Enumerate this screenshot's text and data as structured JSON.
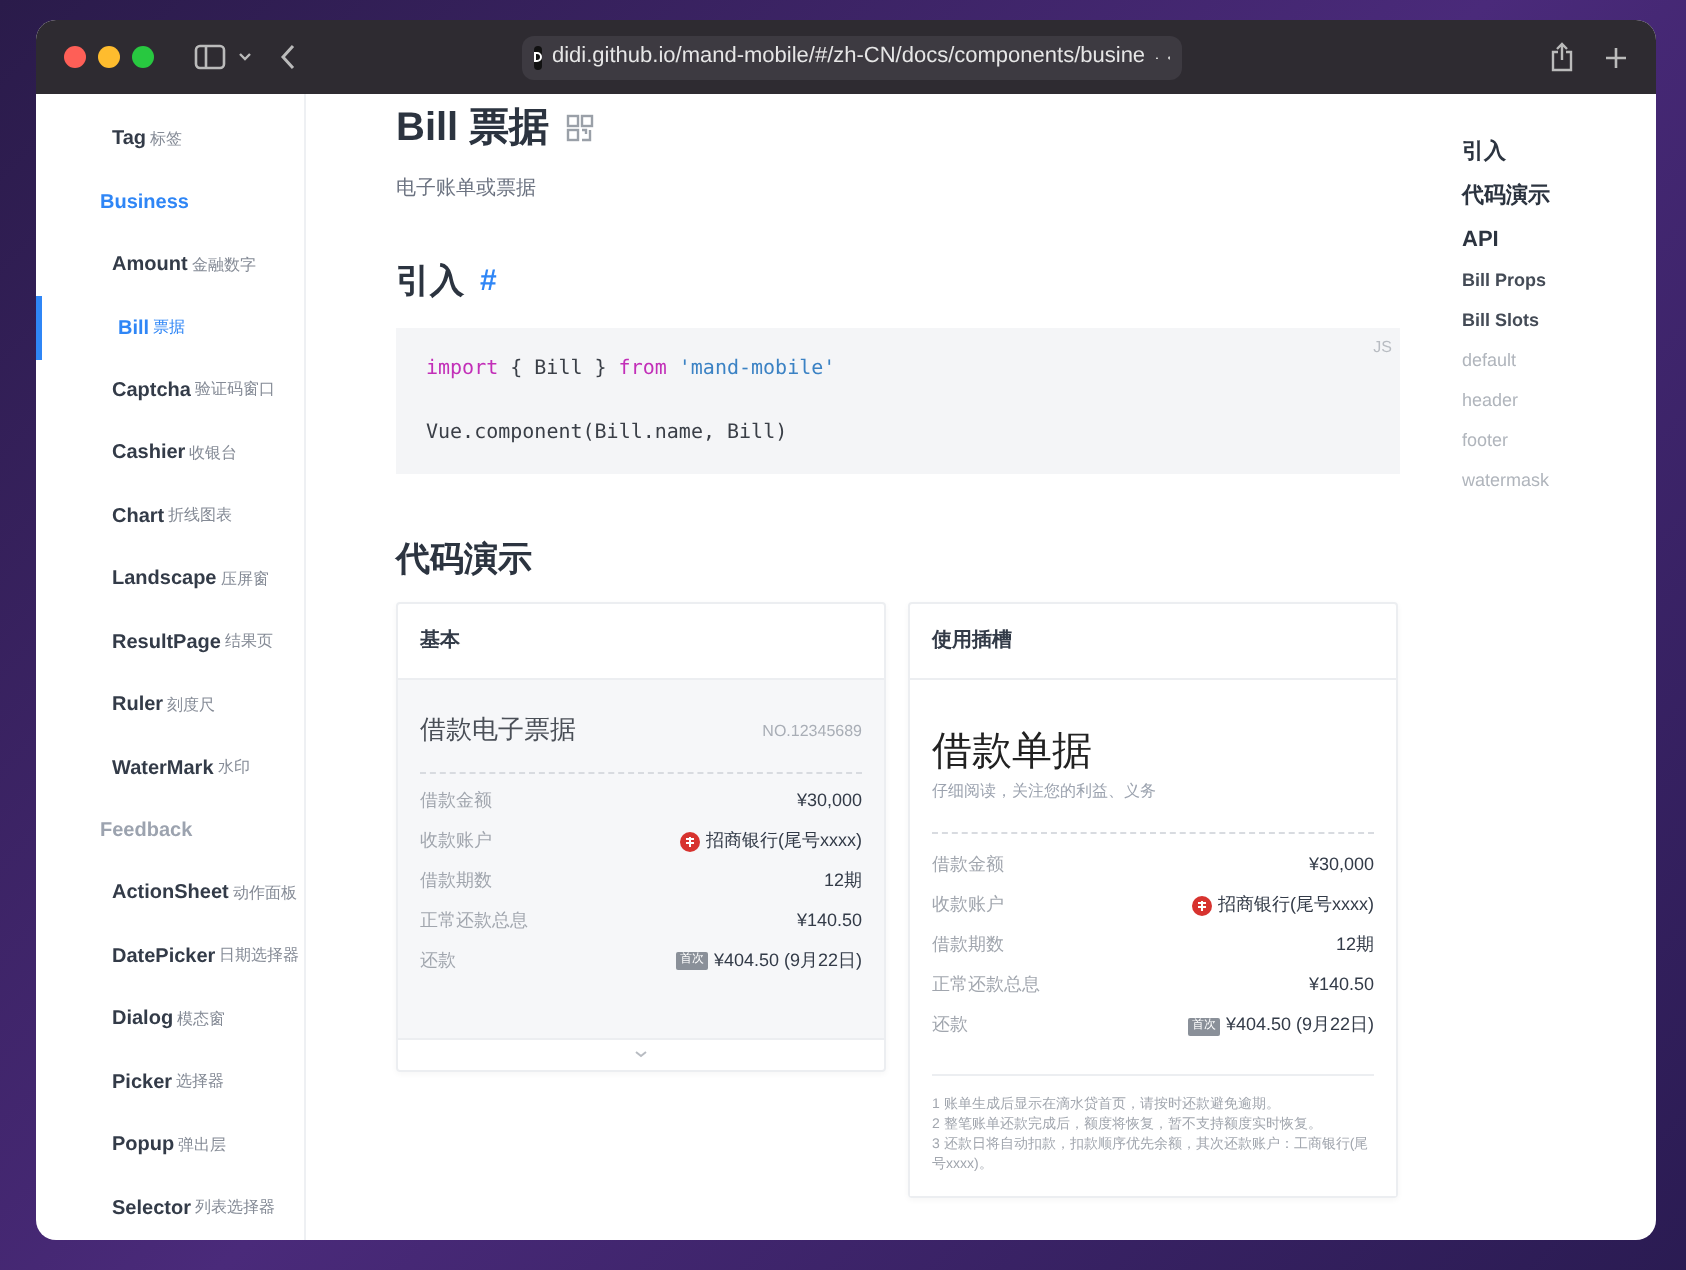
{
  "browser": {
    "url": "didi.github.io/mand-mobile/#/zh-CN/docs/components/busine"
  },
  "sidebar": {
    "items": [
      {
        "kind": "item",
        "name": "Tag",
        "cn": "标签",
        "selected": false
      },
      {
        "kind": "group",
        "name": "Business",
        "selected": true
      },
      {
        "kind": "item",
        "name": "Amount",
        "cn": "金融数字",
        "selected": false
      },
      {
        "kind": "item",
        "name": "Bill",
        "cn": "票据",
        "selected": true
      },
      {
        "kind": "item",
        "name": "Captcha",
        "cn": "验证码窗口",
        "selected": false
      },
      {
        "kind": "item",
        "name": "Cashier",
        "cn": "收银台",
        "selected": false
      },
      {
        "kind": "item",
        "name": "Chart",
        "cn": "折线图表",
        "selected": false
      },
      {
        "kind": "item",
        "name": "Landscape",
        "cn": "压屏窗",
        "selected": false
      },
      {
        "kind": "item",
        "name": "ResultPage",
        "cn": "结果页",
        "selected": false
      },
      {
        "kind": "item",
        "name": "Ruler",
        "cn": "刻度尺",
        "selected": false
      },
      {
        "kind": "item",
        "name": "WaterMark",
        "cn": "水印",
        "selected": false
      },
      {
        "kind": "group",
        "name": "Feedback",
        "selected": false
      },
      {
        "kind": "item",
        "name": "ActionSheet",
        "cn": "动作面板",
        "selected": false
      },
      {
        "kind": "item",
        "name": "DatePicker",
        "cn": "日期选择器",
        "selected": false
      },
      {
        "kind": "item",
        "name": "Dialog",
        "cn": "模态窗",
        "selected": false
      },
      {
        "kind": "item",
        "name": "Picker",
        "cn": "选择器",
        "selected": false
      },
      {
        "kind": "item",
        "name": "Popup",
        "cn": "弹出层",
        "selected": false
      },
      {
        "kind": "item",
        "name": "Selector",
        "cn": "列表选择器",
        "selected": false
      }
    ]
  },
  "page": {
    "title": "Bill 票据",
    "subtitle": "电子账单或票据",
    "import_heading": "引入",
    "anchor": "#",
    "code": {
      "language": "JS",
      "lines": [
        [
          {
            "kind": "keyword",
            "text": "import"
          },
          {
            "kind": "plain",
            "text": "{ Bill }"
          },
          {
            "kind": "keyword",
            "text": "from"
          },
          {
            "kind": "string",
            "text": "'mand-mobile'"
          }
        ],
        [
          {
            "kind": "plain",
            "text": "Vue.component(Bill.name, Bill)"
          }
        ]
      ]
    },
    "demo_heading": "代码演示",
    "demos": [
      {
        "kind": "basic",
        "header": "基本",
        "bill_title": "借款电子票据",
        "bill_no": "NO.12345689",
        "rows": [
          {
            "label": "借款金额",
            "value": "¥30,000"
          },
          {
            "label": "收款账户",
            "value": "招商银行(尾号xxxx)",
            "kind": "bank"
          },
          {
            "label": "借款期数",
            "value": "12期"
          },
          {
            "label": "正常还款总息",
            "value": "¥140.50"
          },
          {
            "label": "还款",
            "value": "¥404.50 (9月22日)",
            "tag": "首次"
          }
        ]
      },
      {
        "kind": "slot",
        "header": "使用插槽",
        "bill_title": "借款单据",
        "bill_subtitle": "仔细阅读，关注您的利益、义务",
        "rows": [
          {
            "label": "借款金额",
            "value": "¥30,000"
          },
          {
            "label": "收款账户",
            "value": "招商银行(尾号xxxx)",
            "kind": "bank"
          },
          {
            "label": "借款期数",
            "value": "12期"
          },
          {
            "label": "正常还款总息",
            "value": "¥140.50"
          },
          {
            "label": "还款",
            "value": "¥404.50 (9月22日)",
            "tag": "首次"
          }
        ],
        "notes": [
          "1 账单生成后显示在滴水贷首页，请按时还款避免逾期。",
          "2 整笔账单还款完成后，额度将恢复，暂不支持额度实时恢复。",
          "3 还款日将自动扣款，扣款顺序优先余额，其次还款账户：工商银行(尾号xxxx)。"
        ]
      }
    ]
  },
  "toc": [
    {
      "kind": "h2",
      "text": "引入"
    },
    {
      "kind": "h2",
      "text": "代码演示"
    },
    {
      "kind": "h2",
      "text": "API"
    },
    {
      "kind": "h3",
      "text": "Bill Props"
    },
    {
      "kind": "h3",
      "text": "Bill Slots"
    },
    {
      "kind": "h4",
      "text": "default"
    },
    {
      "kind": "h4",
      "text": "header"
    },
    {
      "kind": "h4",
      "text": "footer"
    },
    {
      "kind": "h4",
      "text": "watermask"
    }
  ]
}
